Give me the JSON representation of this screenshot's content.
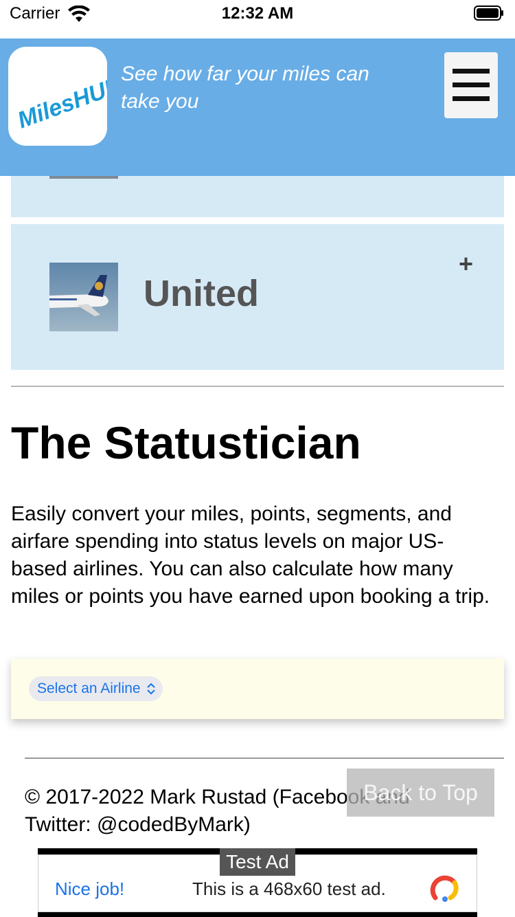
{
  "status_bar": {
    "carrier": "Carrier",
    "time": "12:32 AM"
  },
  "header": {
    "logo_text": "MilesHUB",
    "tagline": "See how far your miles can take you",
    "menu_icon": "hamburger-icon"
  },
  "airlines": [
    {
      "name": "United",
      "expand_icon": "+"
    }
  ],
  "section": {
    "title": "The Statustician",
    "description": "Easily convert your miles, points, segments, and airfare spending into status levels on major US-based airlines. You can also calculate how many miles or points you have earned upon booking a trip."
  },
  "airline_select": {
    "selected": "Select an Airline"
  },
  "footer": {
    "copyright": "© 2017-2022 Mark Rustad (Facebook and Twitter: @codedByMark)",
    "back_to_top": "Back to Top"
  },
  "ad": {
    "label": "Test Ad",
    "headline": "Nice job!",
    "text": "This is a 468x60 test ad."
  },
  "colors": {
    "header_bg": "#68ade6",
    "card_bg": "#d6eaf6",
    "select_bg": "#fefde9",
    "link_blue": "#1a73e8"
  }
}
